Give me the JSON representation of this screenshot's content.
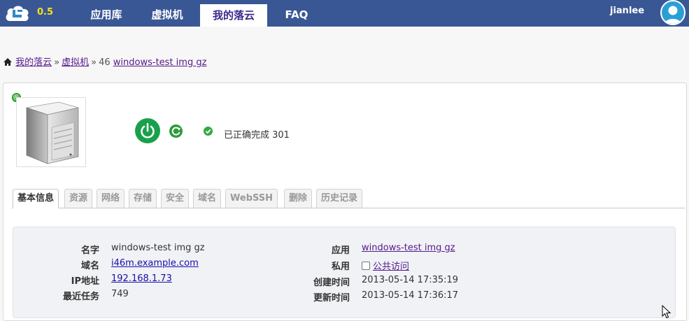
{
  "header": {
    "version": "0.5",
    "nav": [
      {
        "label": "应用库"
      },
      {
        "label": "虚拟机"
      },
      {
        "label": "我的落云"
      },
      {
        "label": "FAQ"
      }
    ],
    "username": "jianlee"
  },
  "breadcrumb": {
    "home": "我的落云",
    "vm": "虚拟机",
    "sep": "»",
    "id": "46",
    "name": "windows-test img gz"
  },
  "status": {
    "text": "已正确完成 301"
  },
  "tabs": [
    {
      "label": "基本信息"
    },
    {
      "label": "资源"
    },
    {
      "label": "网络"
    },
    {
      "label": "存储"
    },
    {
      "label": "安全"
    },
    {
      "label": "域名"
    },
    {
      "label": "WebSSH"
    },
    {
      "label": "删除"
    },
    {
      "label": "历史记录"
    }
  ],
  "info": {
    "name_label": "名字",
    "name_value": "windows-test img gz",
    "domain_label": "域名",
    "domain_value": "i46m.example.com",
    "ip_label": "IP地址",
    "ip_value": "192.168.1.73",
    "task_label": "最近任务",
    "task_value": "749",
    "app_label": "应用",
    "app_value": "windows-test img gz",
    "private_label": "私用",
    "private_value": "公共访问",
    "created_label": "创建时间",
    "created_value": "2013-05-14 17:35:19",
    "updated_label": "更新时间",
    "updated_value": "2013-05-14 17:36:17"
  },
  "colors": {
    "nav_bg": "#3a5795",
    "version": "#f2e11c",
    "power": "#19a04b",
    "link": "#1a0dab",
    "visited": "#551a8b"
  }
}
